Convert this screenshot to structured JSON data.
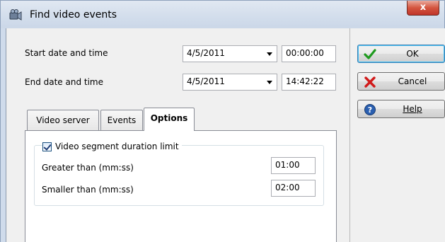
{
  "window": {
    "title": "Find video events",
    "close_symbol": "x"
  },
  "start": {
    "label": "Start date and time",
    "date": "4/5/2011",
    "time": "00:00:00"
  },
  "end": {
    "label": "End date and time",
    "date": "4/5/2011",
    "time": "14:42:22"
  },
  "tabs": [
    {
      "label": "Video server",
      "active": false
    },
    {
      "label": "Events",
      "active": false
    },
    {
      "label": "Options",
      "active": true
    }
  ],
  "options": {
    "duration_limit_label": "Video segment duration limit",
    "duration_limit_checked": true,
    "greater_label": "Greater than (mm:ss)",
    "greater_value": "01:00",
    "smaller_label": "Smaller than (mm:ss)",
    "smaller_value": "02:00"
  },
  "buttons": {
    "ok": {
      "label": "OK",
      "icon": "checkmark-icon"
    },
    "cancel": {
      "label": "Cancel",
      "icon": "x-icon"
    },
    "help": {
      "label": "Help",
      "icon": "help-icon"
    }
  },
  "colors": {
    "ok_icon": "#1e9a1e",
    "cancel_icon": "#d11a1a",
    "help_icon": "#2a5fb0",
    "close_button": "#c7402e"
  }
}
